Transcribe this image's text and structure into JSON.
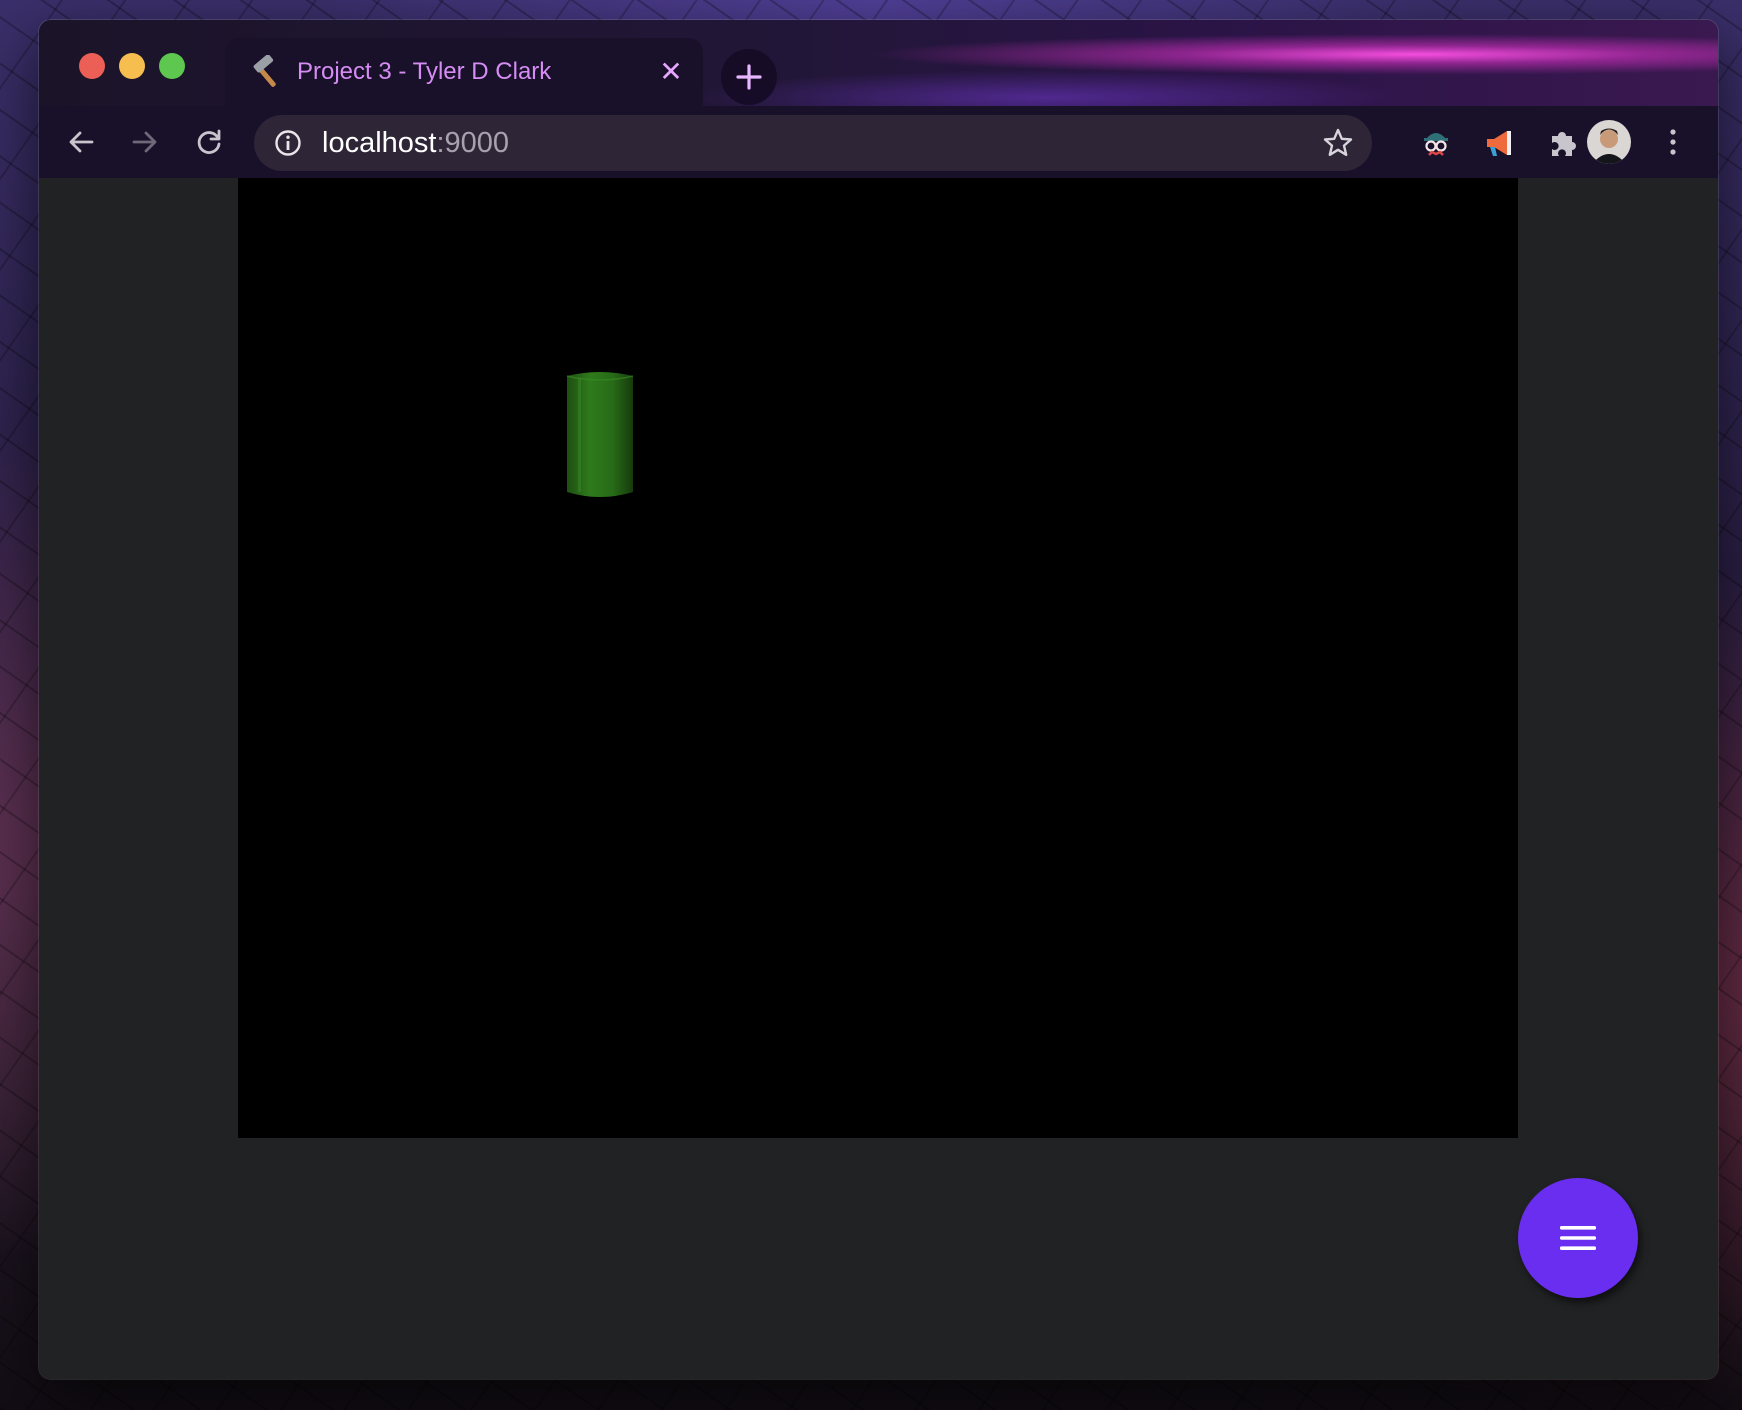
{
  "browser": {
    "tab": {
      "title": "Project 3 - Tyler D Clark",
      "favicon": "hammer-icon",
      "close_icon": "close-icon"
    },
    "new_tab_icon": "plus-icon",
    "toolbar": {
      "back_icon": "back-arrow-icon",
      "forward_icon": "forward-arrow-icon",
      "reload_icon": "reload-icon",
      "site_info_icon": "info-icon",
      "url_host": "localhost",
      "url_port": ":9000",
      "bookmark_icon": "star-icon",
      "extensions": [
        "spy-extension-icon",
        "megaphone-extension-icon",
        "puzzle-extension-icon"
      ],
      "profile_icon": "avatar",
      "menu_icon": "kebab-menu-icon"
    }
  },
  "page": {
    "canvas_background": "#000000",
    "object_color": "#2f7a1c",
    "fab_color": "#6a2ef0",
    "fab_icon": "hamburger-menu-icon"
  }
}
